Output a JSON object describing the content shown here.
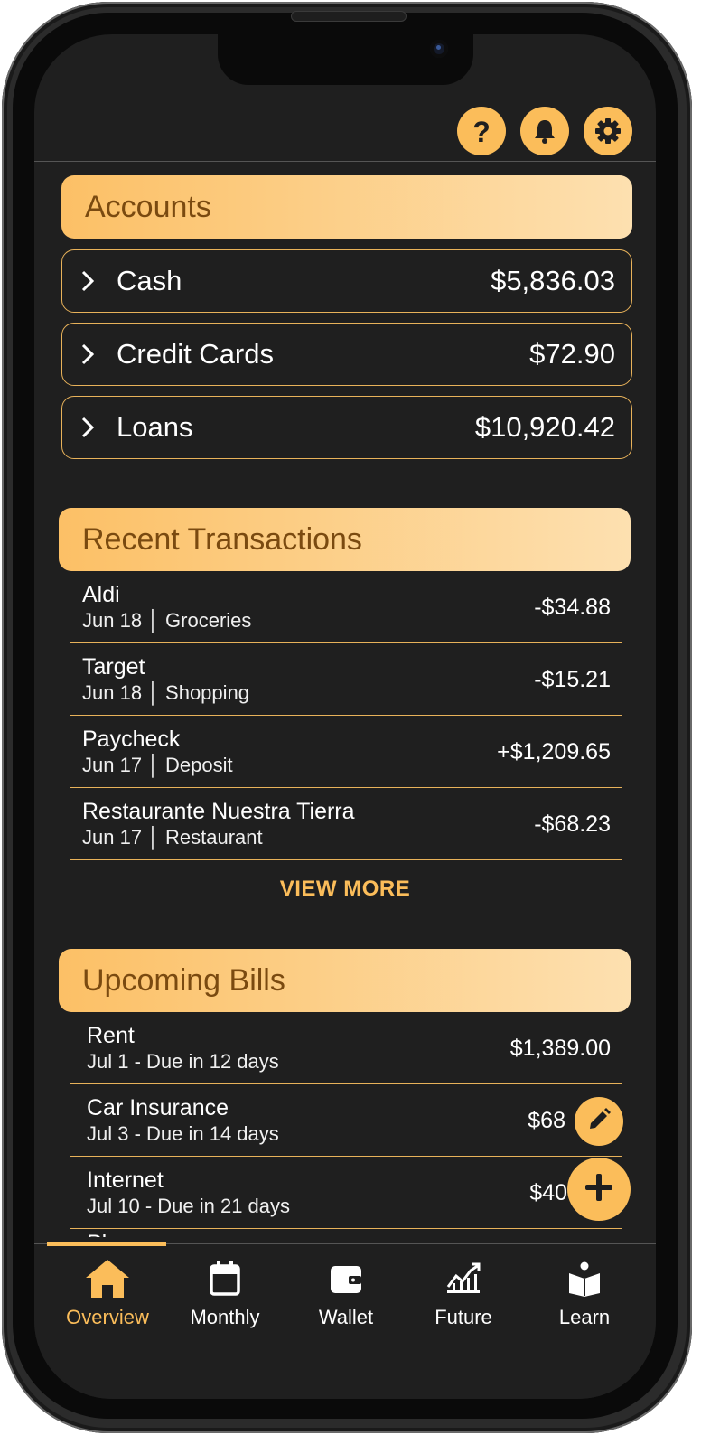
{
  "header": {
    "icons": [
      "help-icon",
      "bell-icon",
      "gear-icon"
    ]
  },
  "accounts": {
    "title": "Accounts",
    "items": [
      {
        "name": "Cash",
        "amount": "$5,836.03"
      },
      {
        "name": "Credit Cards",
        "amount": "$72.90"
      },
      {
        "name": "Loans",
        "amount": "$10,920.42"
      }
    ]
  },
  "transactions": {
    "title": "Recent Transactions",
    "items": [
      {
        "name": "Aldi",
        "detail": "Jun 18 │ Groceries",
        "amount": "-$34.88"
      },
      {
        "name": "Target",
        "detail": "Jun 18 │ Shopping",
        "amount": "-$15.21"
      },
      {
        "name": "Paycheck",
        "detail": "Jun 17 │ Deposit",
        "amount": "+$1,209.65"
      },
      {
        "name": "Restaurante Nuestra Tierra",
        "detail": "Jun 17 │ Restaurant",
        "amount": "-$68.23"
      }
    ],
    "view_more": "VIEW MORE"
  },
  "bills": {
    "title": "Upcoming Bills",
    "items": [
      {
        "name": "Rent",
        "detail": "Jul 1 - Due in 12 days",
        "amount": "$1,389.00"
      },
      {
        "name": "Car Insurance",
        "detail": "Jul 3 - Due in 14 days",
        "amount": "$68"
      },
      {
        "name": "Internet",
        "detail": "Jul 10 - Due in 21 days",
        "amount": "$40"
      },
      {
        "name": "Phone",
        "detail": "",
        "amount": ""
      }
    ]
  },
  "nav": {
    "items": [
      {
        "label": "Overview",
        "icon": "home-icon",
        "active": true
      },
      {
        "label": "Monthly",
        "icon": "calendar-icon",
        "active": false
      },
      {
        "label": "Wallet",
        "icon": "wallet-icon",
        "active": false
      },
      {
        "label": "Future",
        "icon": "chart-icon",
        "active": false
      },
      {
        "label": "Learn",
        "icon": "book-icon",
        "active": false
      }
    ]
  },
  "fabs": [
    "edit-icon",
    "plus-icon"
  ],
  "colors": {
    "accent": "#fbbd5a",
    "background": "#1f1f1f",
    "header_text": "#7a4a10"
  }
}
